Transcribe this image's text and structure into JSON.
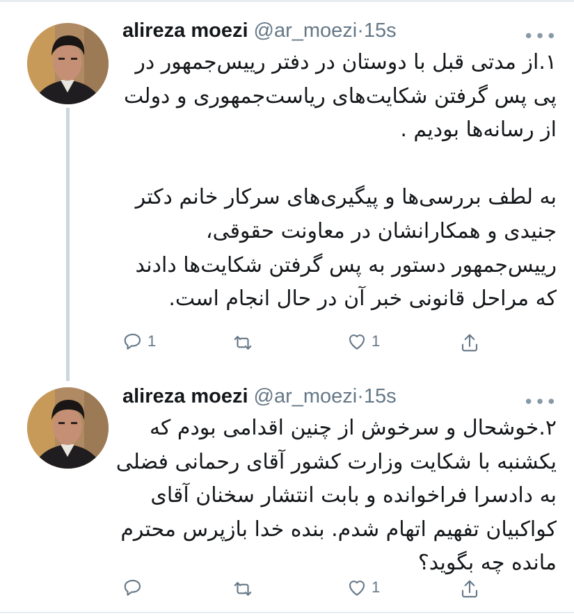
{
  "tweets": [
    {
      "name": "alireza moezi",
      "handle": "@ar_moezi",
      "separator": "·",
      "time": "15s",
      "more": "•••",
      "paragraphs": [
        "۱.از مدتی قبل با دوستان در دفتر رییس‌جمهور در پی پس گرفتن شکایت‌های ریاست‌جمهوری و دولت از رسانه‌ها بودیم .",
        "به لطف بررسی‌ها و پیگیری‌های سرکار خانم دکتر جنیدی و همکارانشان در معاونت حقوقی، رییس‌جمهور دستور به پس گرفتن شکایت‌ها دادند که مراحل قانونی خبر آن در حال انجام است."
      ],
      "actions": {
        "reply_count": "1",
        "retweet_count": "",
        "like_count": "1"
      }
    },
    {
      "name": "alireza moezi",
      "handle": "@ar_moezi",
      "separator": "·",
      "time": "15s",
      "more": "•••",
      "paragraphs": [
        "۲.خوشحال و سرخوش از چنین اقدامی بودم که یکشنبه با شکایت وزارت کشور آقای رحمانی فضلی به دادسرا فراخوانده و بابت انتشار سخنان آقای کواکبیان تفهیم اتهام شدم. بنده خدا بازپرس محترم مانده چه بگوید؟"
      ],
      "actions": {
        "reply_count": "",
        "retweet_count": "",
        "like_count": "1"
      }
    }
  ],
  "icons": {
    "reply": "reply-icon",
    "retweet": "retweet-icon",
    "like": "like-icon",
    "share": "share-icon"
  },
  "colors": {
    "text": "#14171a",
    "secondary": "#657786",
    "thread_line": "#ccd6dd",
    "divider": "#e6ecf0"
  }
}
